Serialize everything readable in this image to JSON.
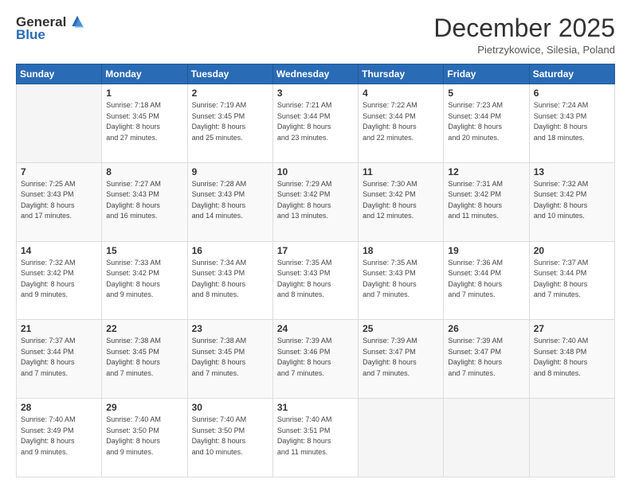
{
  "logo": {
    "general": "General",
    "blue": "Blue"
  },
  "header": {
    "month": "December 2025",
    "location": "Pietrzykowice, Silesia, Poland"
  },
  "days_of_week": [
    "Sunday",
    "Monday",
    "Tuesday",
    "Wednesday",
    "Thursday",
    "Friday",
    "Saturday"
  ],
  "weeks": [
    [
      {
        "day": "",
        "info": ""
      },
      {
        "day": "1",
        "info": "Sunrise: 7:18 AM\nSunset: 3:45 PM\nDaylight: 8 hours\nand 27 minutes."
      },
      {
        "day": "2",
        "info": "Sunrise: 7:19 AM\nSunset: 3:45 PM\nDaylight: 8 hours\nand 25 minutes."
      },
      {
        "day": "3",
        "info": "Sunrise: 7:21 AM\nSunset: 3:44 PM\nDaylight: 8 hours\nand 23 minutes."
      },
      {
        "day": "4",
        "info": "Sunrise: 7:22 AM\nSunset: 3:44 PM\nDaylight: 8 hours\nand 22 minutes."
      },
      {
        "day": "5",
        "info": "Sunrise: 7:23 AM\nSunset: 3:44 PM\nDaylight: 8 hours\nand 20 minutes."
      },
      {
        "day": "6",
        "info": "Sunrise: 7:24 AM\nSunset: 3:43 PM\nDaylight: 8 hours\nand 18 minutes."
      }
    ],
    [
      {
        "day": "7",
        "info": "Sunrise: 7:25 AM\nSunset: 3:43 PM\nDaylight: 8 hours\nand 17 minutes."
      },
      {
        "day": "8",
        "info": "Sunrise: 7:27 AM\nSunset: 3:43 PM\nDaylight: 8 hours\nand 16 minutes."
      },
      {
        "day": "9",
        "info": "Sunrise: 7:28 AM\nSunset: 3:43 PM\nDaylight: 8 hours\nand 14 minutes."
      },
      {
        "day": "10",
        "info": "Sunrise: 7:29 AM\nSunset: 3:42 PM\nDaylight: 8 hours\nand 13 minutes."
      },
      {
        "day": "11",
        "info": "Sunrise: 7:30 AM\nSunset: 3:42 PM\nDaylight: 8 hours\nand 12 minutes."
      },
      {
        "day": "12",
        "info": "Sunrise: 7:31 AM\nSunset: 3:42 PM\nDaylight: 8 hours\nand 11 minutes."
      },
      {
        "day": "13",
        "info": "Sunrise: 7:32 AM\nSunset: 3:42 PM\nDaylight: 8 hours\nand 10 minutes."
      }
    ],
    [
      {
        "day": "14",
        "info": "Sunrise: 7:32 AM\nSunset: 3:42 PM\nDaylight: 8 hours\nand 9 minutes."
      },
      {
        "day": "15",
        "info": "Sunrise: 7:33 AM\nSunset: 3:42 PM\nDaylight: 8 hours\nand 9 minutes."
      },
      {
        "day": "16",
        "info": "Sunrise: 7:34 AM\nSunset: 3:43 PM\nDaylight: 8 hours\nand 8 minutes."
      },
      {
        "day": "17",
        "info": "Sunrise: 7:35 AM\nSunset: 3:43 PM\nDaylight: 8 hours\nand 8 minutes."
      },
      {
        "day": "18",
        "info": "Sunrise: 7:35 AM\nSunset: 3:43 PM\nDaylight: 8 hours\nand 7 minutes."
      },
      {
        "day": "19",
        "info": "Sunrise: 7:36 AM\nSunset: 3:44 PM\nDaylight: 8 hours\nand 7 minutes."
      },
      {
        "day": "20",
        "info": "Sunrise: 7:37 AM\nSunset: 3:44 PM\nDaylight: 8 hours\nand 7 minutes."
      }
    ],
    [
      {
        "day": "21",
        "info": "Sunrise: 7:37 AM\nSunset: 3:44 PM\nDaylight: 8 hours\nand 7 minutes."
      },
      {
        "day": "22",
        "info": "Sunrise: 7:38 AM\nSunset: 3:45 PM\nDaylight: 8 hours\nand 7 minutes."
      },
      {
        "day": "23",
        "info": "Sunrise: 7:38 AM\nSunset: 3:45 PM\nDaylight: 8 hours\nand 7 minutes."
      },
      {
        "day": "24",
        "info": "Sunrise: 7:39 AM\nSunset: 3:46 PM\nDaylight: 8 hours\nand 7 minutes."
      },
      {
        "day": "25",
        "info": "Sunrise: 7:39 AM\nSunset: 3:47 PM\nDaylight: 8 hours\nand 7 minutes."
      },
      {
        "day": "26",
        "info": "Sunrise: 7:39 AM\nSunset: 3:47 PM\nDaylight: 8 hours\nand 7 minutes."
      },
      {
        "day": "27",
        "info": "Sunrise: 7:40 AM\nSunset: 3:48 PM\nDaylight: 8 hours\nand 8 minutes."
      }
    ],
    [
      {
        "day": "28",
        "info": "Sunrise: 7:40 AM\nSunset: 3:49 PM\nDaylight: 8 hours\nand 9 minutes."
      },
      {
        "day": "29",
        "info": "Sunrise: 7:40 AM\nSunset: 3:50 PM\nDaylight: 8 hours\nand 9 minutes."
      },
      {
        "day": "30",
        "info": "Sunrise: 7:40 AM\nSunset: 3:50 PM\nDaylight: 8 hours\nand 10 minutes."
      },
      {
        "day": "31",
        "info": "Sunrise: 7:40 AM\nSunset: 3:51 PM\nDaylight: 8 hours\nand 11 minutes."
      },
      {
        "day": "",
        "info": ""
      },
      {
        "day": "",
        "info": ""
      },
      {
        "day": "",
        "info": ""
      }
    ]
  ]
}
